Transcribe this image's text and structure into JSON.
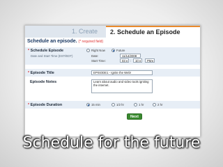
{
  "tabs": {
    "step1": "1. Create",
    "step2_num": "2.",
    "step2": "Schedule an Episode"
  },
  "form": {
    "heading": "Schedule an episode.",
    "required_note": "(* required field)",
    "schedule": {
      "label": "Schedule Episode",
      "sublabel": "Date and Start Time (EST/EDT)",
      "option_now": "Right Now",
      "option_future": "Future",
      "selected": "Future",
      "date_label": "Date:",
      "date_value": "11/14/2008",
      "start_time_label": "Start Time:",
      "hour": "03",
      "minute": "10",
      "ampm": "PM"
    },
    "title": {
      "label": "Episode Title",
      "value": "EPISODE1 - Ignite the Web!"
    },
    "notes": {
      "label": "Episode Notes",
      "value_line1": "Learn about audio and video tools igniting",
      "value_line2": "the internet."
    },
    "duration": {
      "label": "Episode Duration",
      "options": [
        "15 min",
        "1/2 hr",
        "1 hr",
        "2 hr"
      ],
      "selected": "15 min"
    },
    "next_button": "Next"
  },
  "caption": "Schedule for the future",
  "colors": {
    "accent": "#e98a2c",
    "heading": "#15345f",
    "row_bg": "#e7eef6",
    "button": "#3a8a2f"
  }
}
